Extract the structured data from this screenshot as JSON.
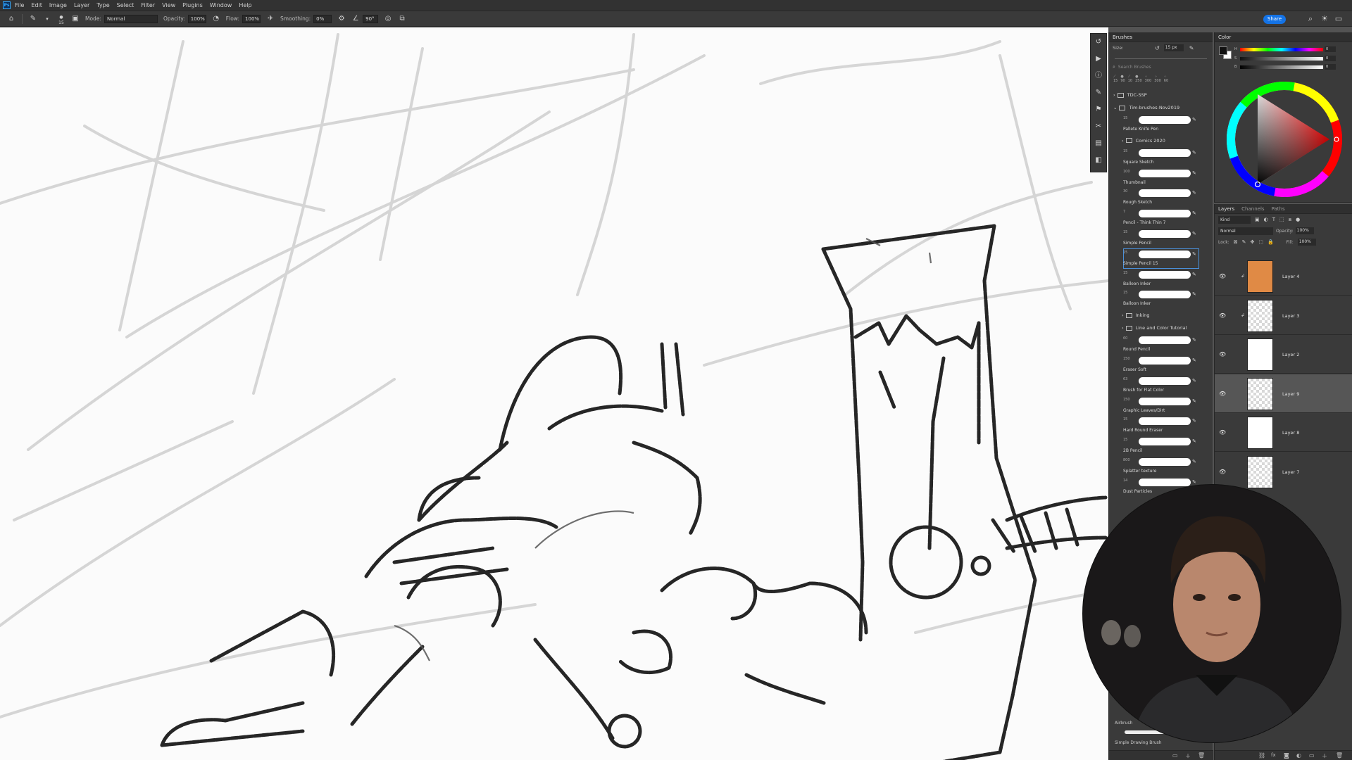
{
  "menubar": {
    "logo": "Ps",
    "items": [
      "File",
      "Edit",
      "Image",
      "Layer",
      "Type",
      "Select",
      "Filter",
      "View",
      "Plugins",
      "Window",
      "Help"
    ]
  },
  "options_bar": {
    "brush_size": "15",
    "mode_label": "Mode:",
    "mode_value": "Normal",
    "opacity_label": "Opacity:",
    "opacity_value": "100%",
    "flow_label": "Flow:",
    "flow_value": "100%",
    "smoothing_label": "Smoothing:",
    "smoothing_value": "0%",
    "angle_value": "90°",
    "share_label": "Share"
  },
  "brushes_panel": {
    "tab": "Brushes",
    "size_label": "Size:",
    "size_value": "15 px",
    "search_placeholder": "Search Brushes",
    "preset_sizes": [
      "15",
      "90",
      "10",
      "250",
      "300",
      "300",
      "60"
    ],
    "groups": [
      {
        "name": "TDC-SSP",
        "type": "folder"
      },
      {
        "name": "Tim-brushes-Nov2019",
        "type": "folder"
      }
    ],
    "brushes": [
      {
        "num": "15",
        "name": "Pallete Knife Pen"
      },
      {
        "group": "Comics 2020"
      },
      {
        "num": "15",
        "name": "Square Sketch"
      },
      {
        "num": "100",
        "name": "Thumbnail"
      },
      {
        "num": "30",
        "name": "Rough Sketch"
      },
      {
        "num": "7",
        "name": "Pencil - Think Thin 7"
      },
      {
        "num": "15",
        "name": "Simple Pencil"
      },
      {
        "num": "15",
        "name": "Simple Pencil 15",
        "selected": true
      },
      {
        "num": "15",
        "name": "Balloon Inker"
      },
      {
        "num": "15",
        "name": "Balloon Inker"
      },
      {
        "group": "Inking"
      },
      {
        "group": "Line and Color Tutorial"
      },
      {
        "num": "60",
        "name": "Round Pencil"
      },
      {
        "num": "150",
        "name": "Eraser Soft"
      },
      {
        "num": "63",
        "name": "Brush for Flat Color"
      },
      {
        "num": "150",
        "name": "Graphic Leaves/Dirt"
      },
      {
        "num": "15",
        "name": "Hard Round Eraser"
      },
      {
        "num": "15",
        "name": "2B Pencil"
      },
      {
        "num": "800",
        "name": "Splatter texture"
      },
      {
        "num": "14",
        "name": "Dust Particles"
      }
    ],
    "bottom_items": [
      "Airbrush",
      "Simple Drawing Brush"
    ]
  },
  "color_panel": {
    "tab": "Color",
    "sliders": [
      {
        "label": "H",
        "value": "0"
      },
      {
        "label": "S",
        "value": "0"
      },
      {
        "label": "B",
        "value": "0"
      }
    ],
    "foreground": "#111111",
    "background": "#ffffff"
  },
  "layers_panel": {
    "tabs": [
      "Layers",
      "Channels",
      "Paths"
    ],
    "filter": "Kind",
    "blend_mode": "Normal",
    "opacity_label": "Opacity:",
    "opacity_value": "100%",
    "lock_label": "Lock:",
    "fill_label": "Fill:",
    "fill_value": "100%",
    "layers": [
      {
        "name": "Layer 4",
        "thumb": "orange",
        "color": "#e08a45"
      },
      {
        "name": "Layer 3",
        "thumb": "checker"
      },
      {
        "name": "Layer 2",
        "thumb": "white"
      },
      {
        "name": "Layer 9",
        "thumb": "checker",
        "selected": true
      },
      {
        "name": "Layer 8",
        "thumb": "white"
      },
      {
        "name": "Layer 7",
        "thumb": "sketch"
      }
    ]
  },
  "tool_strip_icons": [
    "history-icon",
    "play-icon",
    "info-icon",
    "brush-settings-icon",
    "clone-source-icon",
    "tool-presets-icon",
    "properties-icon",
    "adjustments-icon"
  ],
  "accent": "#1473e6"
}
